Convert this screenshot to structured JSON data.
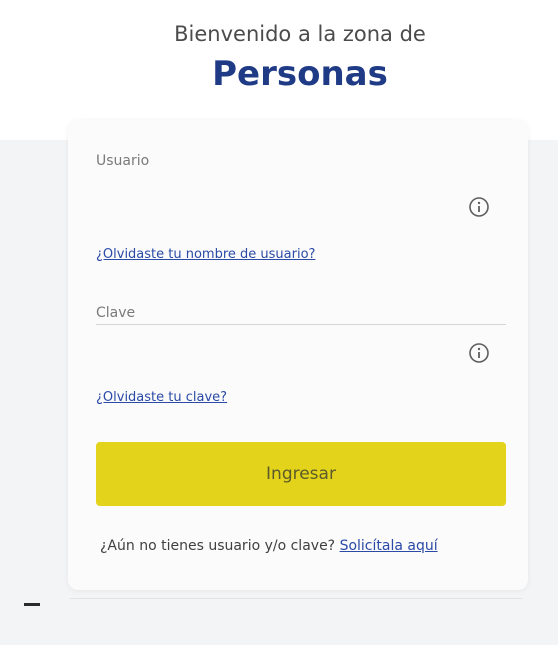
{
  "header": {
    "welcome": "Bienvenido a la zona de",
    "zone_title": "Personas"
  },
  "form": {
    "username_label": "Usuario",
    "username_value": "",
    "forgot_username_link": "¿Olvidaste tu nombre de usuario?",
    "password_label": "Clave",
    "password_value": "",
    "forgot_password_link": "¿Olvidaste tu clave?",
    "submit_label": "Ingresar"
  },
  "signup": {
    "prompt": "¿Aún no tienes usuario y/o clave?",
    "link_label": "Solicítala aquí"
  },
  "icons": {
    "info": "info-circle-icon"
  },
  "colors": {
    "brand_blue": "#1f3b86",
    "link_blue": "#2a4aa6",
    "button_yellow": "#e3d31a"
  }
}
